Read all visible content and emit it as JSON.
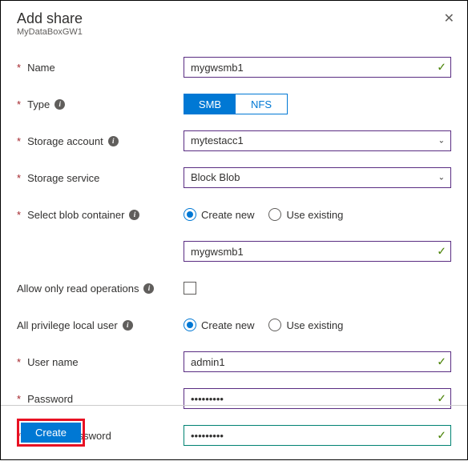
{
  "header": {
    "title": "Add share",
    "subtitle": "MyDataBoxGW1"
  },
  "fields": {
    "name": {
      "label": "Name",
      "value": "mygwsmb1"
    },
    "type": {
      "label": "Type",
      "opt1": "SMB",
      "opt2": "NFS"
    },
    "storage_account": {
      "label": "Storage account",
      "value": "mytestacc1"
    },
    "storage_service": {
      "label": "Storage service",
      "value": "Block Blob"
    },
    "blob_container": {
      "label": "Select blob container",
      "opt1": "Create new",
      "opt2": "Use existing",
      "value": "mygwsmb1"
    },
    "readonly": {
      "label": "Allow only read operations"
    },
    "local_user": {
      "label": "All privilege local user",
      "opt1": "Create new",
      "opt2": "Use existing"
    },
    "username": {
      "label": "User name",
      "value": "admin1"
    },
    "password": {
      "label": "Password",
      "value": "•••••••••"
    },
    "confirm": {
      "label": "Confirm password",
      "value": "•••••••••"
    }
  },
  "footer": {
    "create": "Create"
  }
}
